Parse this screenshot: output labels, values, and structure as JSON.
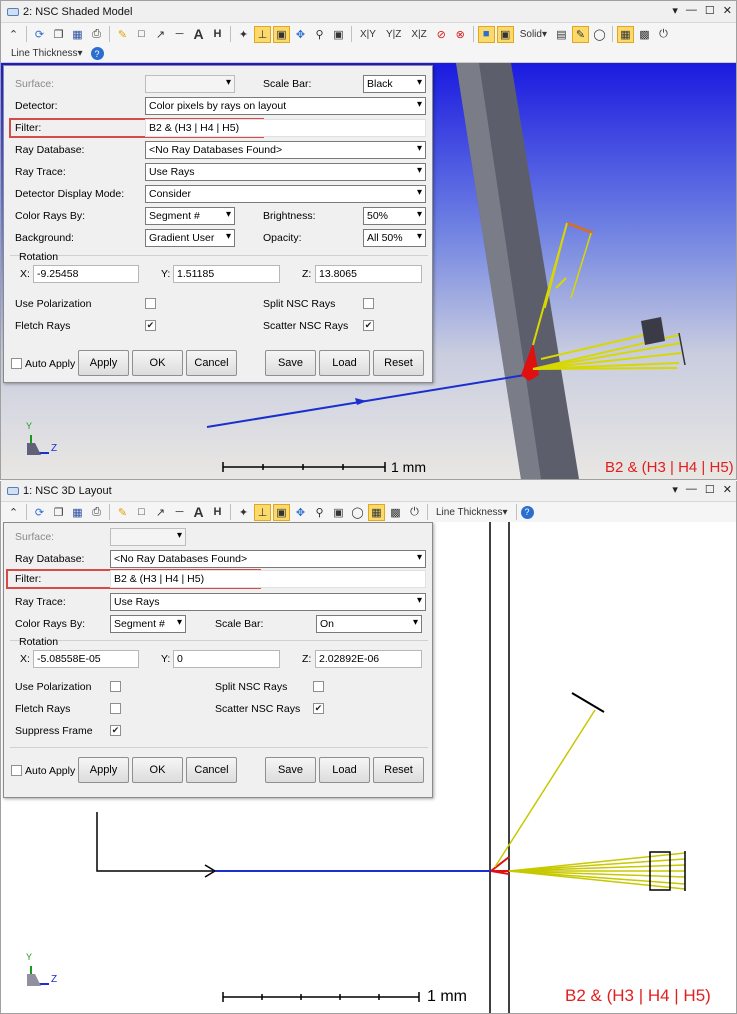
{
  "top": {
    "title": "2: NSC Shaded Model",
    "toolbar2_label": "Line Thickness",
    "toolbar_text": {
      "solid": "Solid"
    },
    "panel": {
      "surface_label": "Surface:",
      "scale_bar_label": "Scale Bar:",
      "scale_bar_value": "Black",
      "detector_label": "Detector:",
      "detector_value": "Color pixels by rays on layout",
      "filter_label": "Filter:",
      "filter_value": "B2 & (H3 | H4 | H5)",
      "ray_db_label": "Ray Database:",
      "ray_db_value": "<No Ray Databases Found>",
      "ray_trace_label": "Ray Trace:",
      "ray_trace_value": "Use Rays",
      "det_mode_label": "Detector Display Mode:",
      "det_mode_value": "Consider",
      "color_by_label": "Color Rays By:",
      "color_by_value": "Segment #",
      "brightness_label": "Brightness:",
      "brightness_value": "50%",
      "background_label": "Background:",
      "background_value": "Gradient User",
      "opacity_label": "Opacity:",
      "opacity_value": "All 50%",
      "rotation_label": "Rotation",
      "x_label": "X:",
      "x_value": "-9.25458",
      "y_label": "Y:",
      "y_value": "1.51185",
      "z_label": "Z:",
      "z_value": "13.8065",
      "polarization_label": "Use Polarization",
      "split_label": "Split NSC Rays",
      "fletch_label": "Fletch Rays",
      "scatter_label": "Scatter NSC Rays",
      "auto_apply": "Auto Apply",
      "apply": "Apply",
      "ok": "OK",
      "cancel": "Cancel",
      "save": "Save",
      "load": "Load",
      "reset": "Reset"
    },
    "scale_label": "1 mm",
    "status": "B2 & (H3 | H4 | H5)",
    "axis": {
      "y": "Y",
      "z": "Z"
    }
  },
  "bottom": {
    "title": "1: NSC 3D Layout",
    "toolbar_label": "Line Thickness",
    "panel": {
      "surface_label": "Surface:",
      "ray_db_label": "Ray Database:",
      "ray_db_value": "<No Ray Databases Found>",
      "filter_label": "Filter:",
      "filter_value": "B2 & (H3 | H4 | H5)",
      "ray_trace_label": "Ray Trace:",
      "ray_trace_value": "Use Rays",
      "color_by_label": "Color Rays By:",
      "color_by_value": "Segment #",
      "scale_bar_label": "Scale Bar:",
      "scale_bar_value": "On",
      "rotation_label": "Rotation",
      "x_label": "X:",
      "x_value": "-5.08558E-05",
      "y_label": "Y:",
      "y_value": "0",
      "z_label": "Z:",
      "z_value": "2.02892E-06",
      "polarization_label": "Use Polarization",
      "split_label": "Split NSC Rays",
      "fletch_label": "Fletch Rays",
      "scatter_label": "Scatter NSC Rays",
      "suppress_label": "Suppress Frame",
      "auto_apply": "Auto Apply",
      "apply": "Apply",
      "ok": "OK",
      "cancel": "Cancel",
      "save": "Save",
      "load": "Load",
      "reset": "Reset"
    },
    "scale_label": "1 mm",
    "status": "B2 & (H3 | H4 | H5)",
    "axis": {
      "y": "Y",
      "z": "Z"
    }
  },
  "colors": {
    "highlight": "#d64a4a",
    "status": "#e02020",
    "ray_blue": "#1a2fd0",
    "ray_yellow": "#d8d800",
    "ray_red": "#e01010"
  }
}
